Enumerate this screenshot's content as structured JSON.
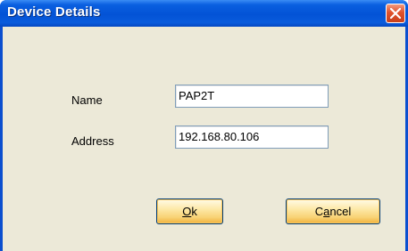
{
  "window": {
    "title": "Device Details"
  },
  "form": {
    "name_label": "Name",
    "name_value": "PAP2T",
    "address_label": "Address",
    "address_value": "192.168.80.106"
  },
  "buttons": {
    "ok_mnemonic": "O",
    "ok_rest": "k",
    "cancel_start": "C",
    "cancel_mnemonic": "a",
    "cancel_rest": "ncel"
  },
  "icons": {
    "close": "close-icon"
  },
  "colors": {
    "titlebar": "#0353d6",
    "close": "#e0522c",
    "face": "#ece9d8",
    "button": "#f8d275"
  }
}
